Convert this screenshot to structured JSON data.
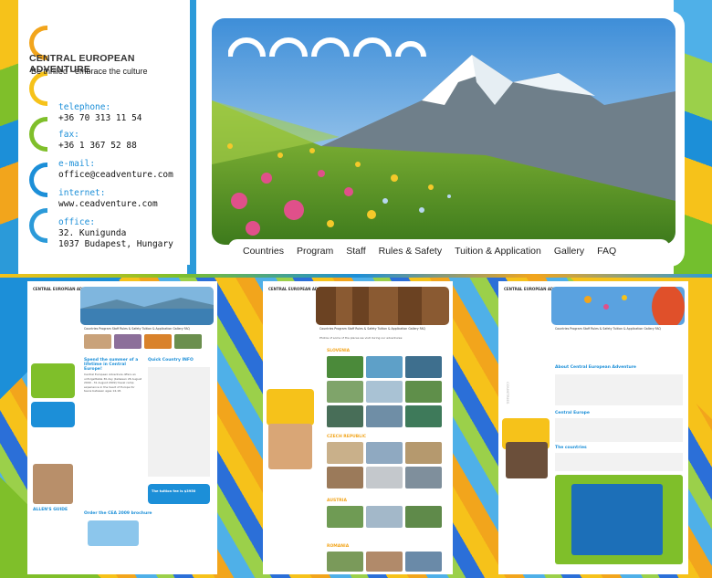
{
  "brand": {
    "name": "CENTRAL EUROPEAN ADVENTURE",
    "tagline": "Be thrilled - embrace the culture"
  },
  "contact": {
    "telephone_label": "telephone:",
    "telephone": "+36 70 313 11 54",
    "fax_label": "fax:",
    "fax": "+36 1 367 52 88",
    "email_label": "e-mail:",
    "email": "office@ceadventure.com",
    "internet_label": "internet:",
    "internet": "www.ceadventure.com",
    "office_label": "office:",
    "office_line1": "32. Kunigunda",
    "office_line2": "1037 Budapest, Hungary"
  },
  "nav": {
    "items": [
      "Countries",
      "Program",
      "Staff",
      "Rules & Safety",
      "Tuition & Application",
      "Gallery",
      "FAQ"
    ]
  },
  "thumbs": {
    "t1": {
      "nav": "Countries   Program   Staff   Rules & Safety   Tuition & Application   Gallery   FAQ",
      "head1": "Spend the summer of a lifetime in Central Europe!",
      "head2": "Quick Country INFO",
      "body": "Central European Adventure offers an unforgettable 30-day (between 26 August 2009 - 31 August 2009) travel camp experience in the heart of Europe for teens between ages 14-18.",
      "head3": "Order the CEA 2009 brochure",
      "promo": "The tuition fee is $3950",
      "guide": "ALLEN'S GUIDE"
    },
    "t2": {
      "nav": "Countries   Program   Staff   Rules & Safety   Tuition & Application   Gallery   FAQ",
      "intro": "Photos of some of the places we visit during our adventures:",
      "h1": "SLOVENIA",
      "h2": "CZECH REPUBLIC",
      "h3": "AUSTRIA",
      "h4": "ROMANIA"
    },
    "t3": {
      "nav": "Countries   Program   Staff   Rules & Safety   Tuition & Application   Gallery   FAQ",
      "h1": "About Central European Adventure",
      "h2": "Central Europe",
      "h3": "The countries",
      "side": "COUNTRIES"
    }
  },
  "colors": {
    "accent_blue": "#1c8fd8",
    "accent_yellow": "#f6c21a",
    "accent_green": "#7fbf2a",
    "accent_orange": "#f2a51c"
  }
}
